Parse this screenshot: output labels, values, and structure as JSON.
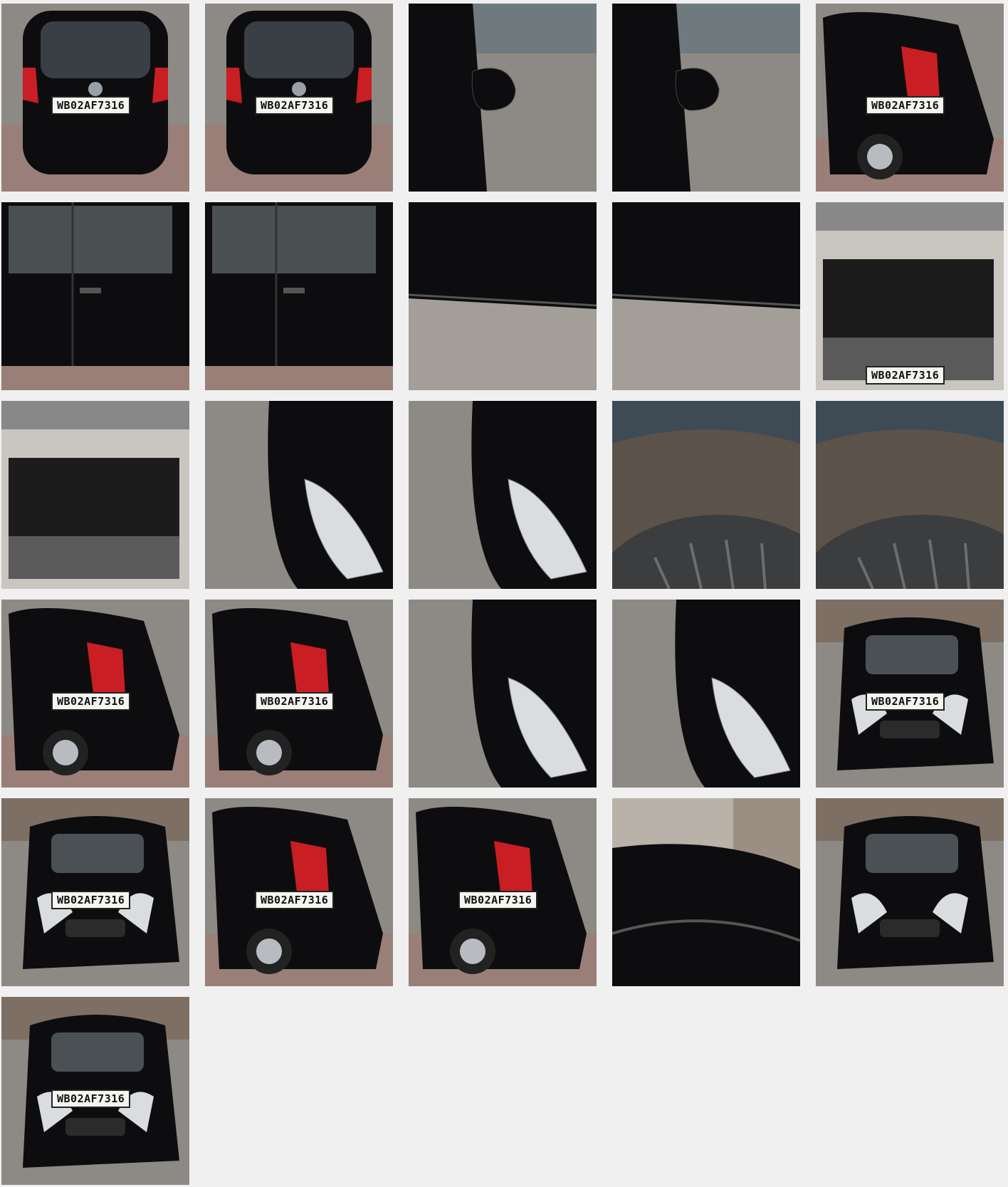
{
  "gallery": {
    "plate_text": "WB02AF7316",
    "colors": {
      "background": "#f0f0f0",
      "car_body": "#0d0d0f",
      "road": "#8d8a85",
      "pavement": "#9a7f78",
      "tail_light": "#c81e24"
    },
    "photos": [
      {
        "view": "rear",
        "plate": true
      },
      {
        "view": "rear",
        "plate": true
      },
      {
        "view": "side-mirror"
      },
      {
        "view": "side-mirror"
      },
      {
        "view": "rear-quarter",
        "plate": true
      },
      {
        "view": "doors"
      },
      {
        "view": "doors"
      },
      {
        "view": "door-sill"
      },
      {
        "view": "door-sill"
      },
      {
        "view": "boot",
        "plate": true
      },
      {
        "view": "boot"
      },
      {
        "view": "headlight"
      },
      {
        "view": "headlight"
      },
      {
        "view": "wheel-arch"
      },
      {
        "view": "wheel-arch"
      },
      {
        "view": "rear-quarter",
        "plate": true
      },
      {
        "view": "rear-quarter",
        "plate": true
      },
      {
        "view": "headlight"
      },
      {
        "view": "headlight"
      },
      {
        "view": "front",
        "plate": true
      },
      {
        "view": "front",
        "plate": true
      },
      {
        "view": "rear-quarter",
        "plate": true
      },
      {
        "view": "rear-quarter",
        "plate": true
      },
      {
        "view": "roof"
      },
      {
        "view": "front"
      },
      {
        "view": "front",
        "plate": true
      }
    ]
  }
}
